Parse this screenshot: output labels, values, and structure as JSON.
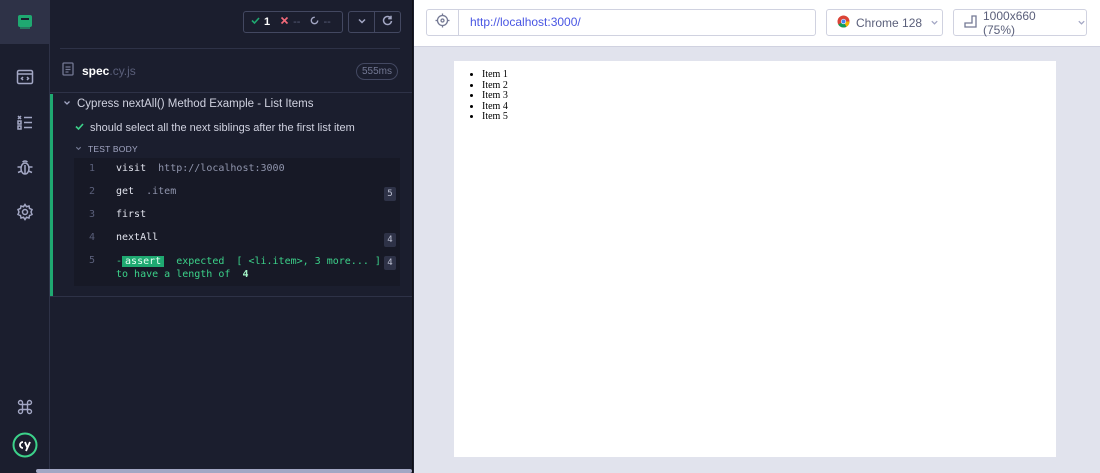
{
  "tooltip": "learnCypress",
  "nav_icons": [
    "specs-icon",
    "runs-icon",
    "debug-icon",
    "settings-icon",
    "keyboard-shortcuts-icon",
    "cypress-logo-icon"
  ],
  "stats": {
    "passed": "1",
    "failed": "--",
    "pending": "--"
  },
  "spec": {
    "name": "spec",
    "ext": ".cy.js",
    "duration": "555ms"
  },
  "suite": {
    "title": "Cypress nextAll() Method Example - List Items",
    "test_title": "should select all the next siblings after the first list item",
    "section_label": "TEST BODY",
    "commands": [
      {
        "num": "1",
        "name": "visit",
        "message": "http://localhost:3000",
        "badge": ""
      },
      {
        "num": "2",
        "name": "get",
        "message": ".item",
        "badge": "5"
      },
      {
        "num": "3",
        "name": "first",
        "message": "",
        "badge": ""
      },
      {
        "num": "4",
        "name": "nextAll",
        "message": "",
        "badge": "4"
      },
      {
        "num": "5",
        "name": "-assert",
        "tag": "assert",
        "message_line1": "expected  [ <li.item>, 3 more... ]",
        "message_line2": "to have a length of",
        "message_value": "4",
        "badge": "4"
      }
    ]
  },
  "aut": {
    "url": "http://localhost:3000/",
    "browser": "Chrome 128",
    "viewport": "1000x660 (75%)",
    "list_items": [
      "Item 1",
      "Item 2",
      "Item 3",
      "Item 4",
      "Item 5"
    ]
  },
  "colors": {
    "pass": "#1fa971",
    "rail_bg": "#1b1e2e",
    "url": "#4956e3"
  }
}
